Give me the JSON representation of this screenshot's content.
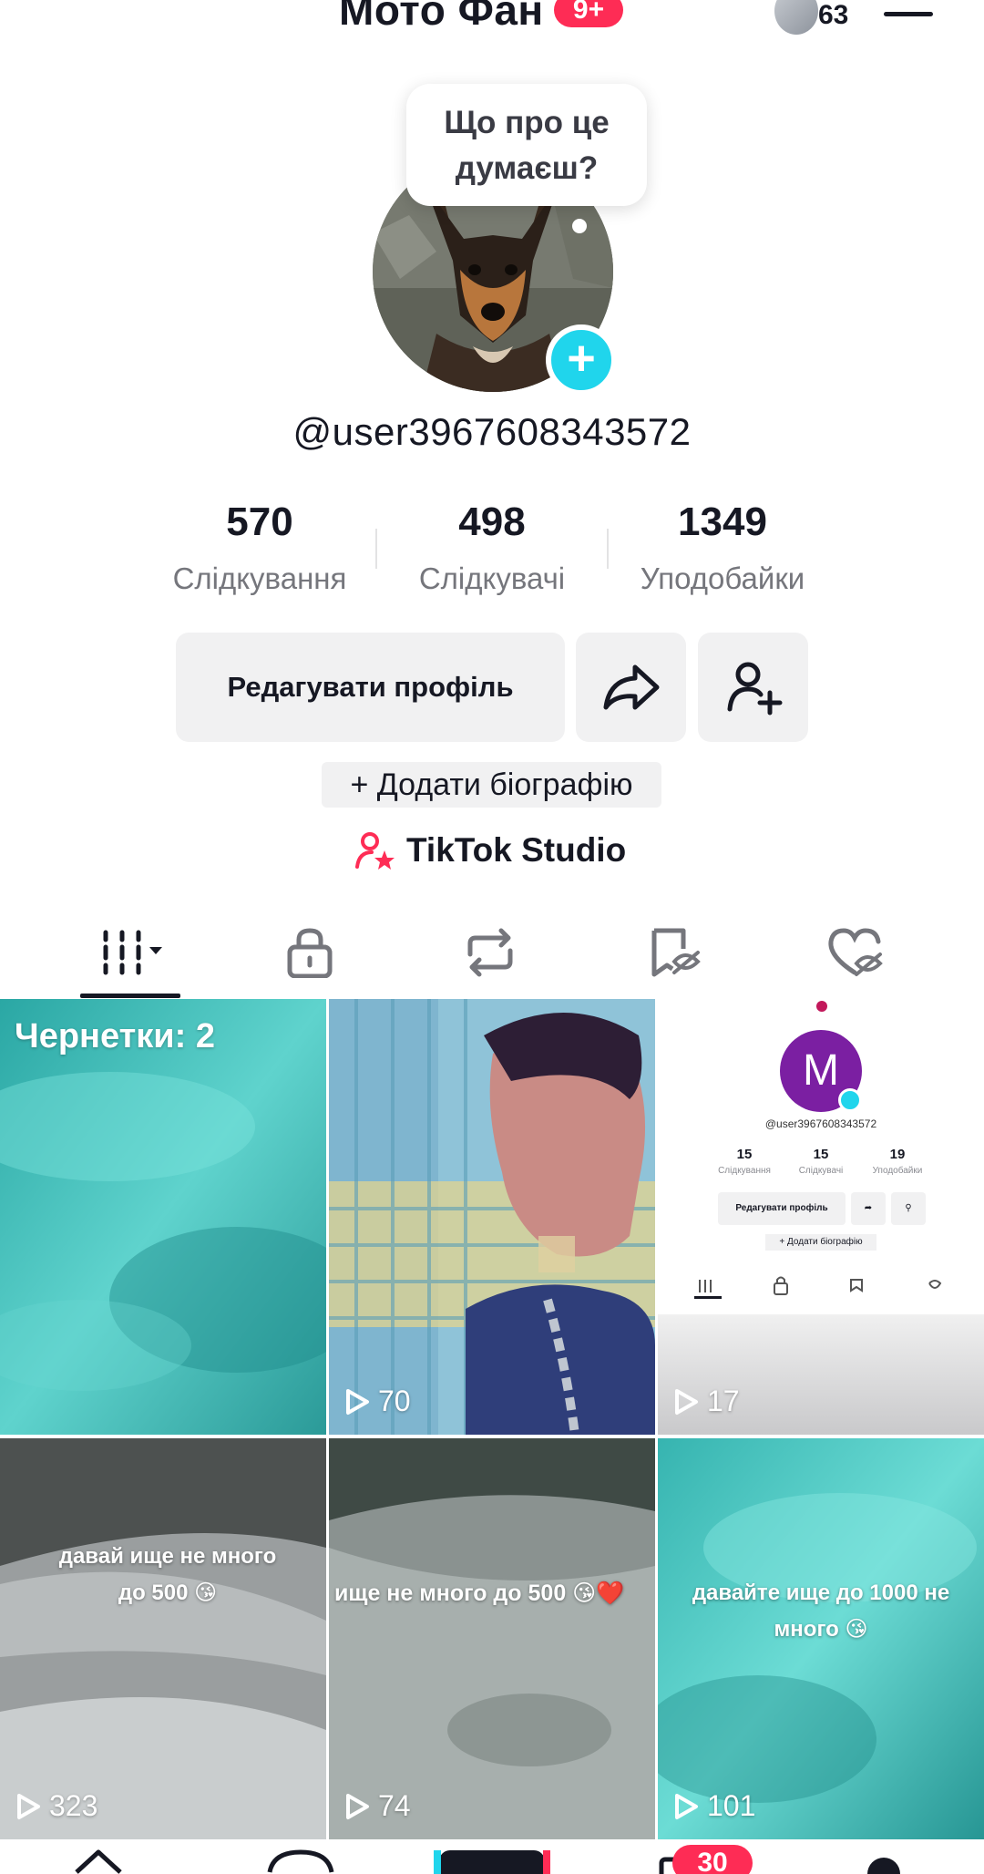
{
  "header": {
    "title": "Мото Фан",
    "badge": "9+",
    "avatar_count": "63"
  },
  "profile": {
    "bubble_text": "Що про це думаєш?",
    "username": "@user3967608343572",
    "stats": [
      {
        "value": "570",
        "label": "Слідкування"
      },
      {
        "value": "498",
        "label": "Слідкувачі"
      },
      {
        "value": "1349",
        "label": "Уподобайки"
      }
    ],
    "edit_button": "Редагувати профіль",
    "add_bio": "+ Додати біографію",
    "studio": "TikTok Studio"
  },
  "tabs": [
    {
      "icon": "grid-icon",
      "active": true
    },
    {
      "icon": "lock-icon",
      "active": false
    },
    {
      "icon": "repost-icon",
      "active": false
    },
    {
      "icon": "saved-icon",
      "active": false
    },
    {
      "icon": "liked-icon",
      "active": false
    }
  ],
  "videos": [
    {
      "kind": "drafts",
      "label": "Чернетки: 2"
    },
    {
      "views": "70"
    },
    {
      "views": "17",
      "mini": {
        "avatar_letter": "M",
        "username": "@user3967608343572",
        "stats": [
          {
            "value": "15",
            "label": "Слідкування"
          },
          {
            "value": "15",
            "label": "Слідкувачі"
          },
          {
            "value": "19",
            "label": "Уподобайки"
          }
        ],
        "edit_button": "Редагувати профіль",
        "add_bio": "+ Додати біографію"
      }
    },
    {
      "caption": "давай ище не много до 500 😘",
      "views": "323"
    },
    {
      "caption": "ище не много до 500 😘❤️",
      "views": "74"
    },
    {
      "caption": "давайте ище до 1000 не много 😘",
      "views": "101"
    }
  ],
  "nav": {
    "inbox_badge": "30"
  },
  "colors": {
    "accent": "#fe2c55",
    "plus": "#20d5ec",
    "text": "#161823",
    "secondary": "#75767c",
    "button_bg": "#f1f1f2"
  }
}
